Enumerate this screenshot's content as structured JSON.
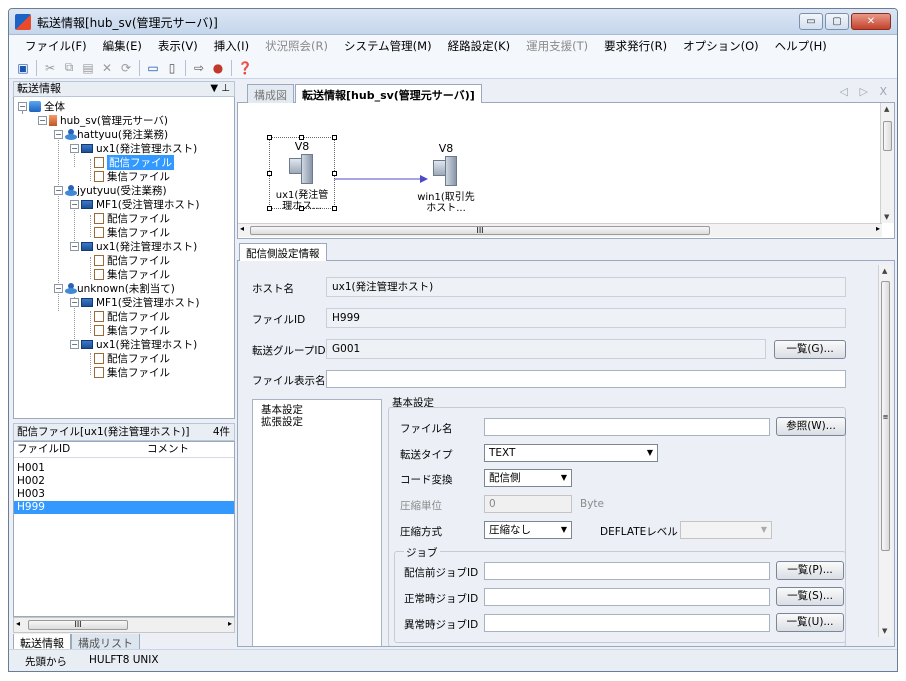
{
  "window": {
    "title": "転送情報[hub_sv(管理元サーバ)]",
    "min_glyph": "▭",
    "max_glyph": "▢",
    "close_glyph": "✕"
  },
  "menu": [
    {
      "label": "ファイル(F)",
      "disabled": false
    },
    {
      "label": "編集(E)",
      "disabled": false
    },
    {
      "label": "表示(V)",
      "disabled": false
    },
    {
      "label": "挿入(I)",
      "disabled": false
    },
    {
      "label": "状況照会(R)",
      "disabled": true
    },
    {
      "label": "システム管理(M)",
      "disabled": false
    },
    {
      "label": "経路設定(K)",
      "disabled": false
    },
    {
      "label": "運用支援(T)",
      "disabled": true
    },
    {
      "label": "要求発行(R)",
      "disabled": false
    },
    {
      "label": "オプション(O)",
      "disabled": false
    },
    {
      "label": "ヘルプ(H)",
      "disabled": false
    }
  ],
  "toolbar": {
    "icons": [
      "save-icon",
      "cut-icon",
      "copy-icon",
      "paste-icon",
      "delete-icon",
      "refresh-icon",
      "new-host-icon",
      "new-file-icon",
      "transfer-icon",
      "stop-icon",
      "help-icon"
    ],
    "glyphs": {
      "save": "▣",
      "cut": "✂",
      "copy": "⧉",
      "paste": "▤",
      "delete": "✕",
      "refresh": "⟳",
      "new_host": "▭",
      "new_file": "▯",
      "transfer": "⇨",
      "stop": "●",
      "help": "❓"
    }
  },
  "left_panel": {
    "header": "転送情報",
    "pin_glyph": "▼ ⊥",
    "tree": {
      "root": "全体",
      "server": "hub_sv(管理元サーバ)",
      "groups": [
        {
          "label": "hattyuu(発注業務)"
        },
        {
          "label": "jyutyuu(受注業務)"
        },
        {
          "label": "unknown(未割当て)"
        }
      ],
      "hosts": {
        "h1": "ux1(発注管理ホスト)",
        "h2": "MF1(受注管理ホスト)",
        "h3": "ux1(発注管理ホスト)",
        "h4": "MF1(受注管理ホスト)",
        "h5": "ux1(発注管理ホスト)"
      },
      "send_file": "配信ファイル",
      "recv_file": "集信ファイル"
    },
    "list_header": "配信ファイル[ux1(発注管理ホスト)]",
    "list_count": "4件",
    "list_columns": [
      "ファイルID",
      "コメント"
    ],
    "list_rows": [
      "H001",
      "H002",
      "H003",
      "H999"
    ],
    "selected_row": "H999",
    "scroll_grip": "III",
    "bottom_tabs": [
      "転送情報",
      "構成リスト"
    ]
  },
  "doc_tabs": {
    "inactive": "構成図",
    "active": "転送情報[hub_sv(管理元サーバ)]",
    "controls": "◁ ▷ X"
  },
  "diagram": {
    "nodes": [
      {
        "version": "V8",
        "label": "ux1(発注管\n理ホス..."
      },
      {
        "version": "V8",
        "label": "win1(取引先\nホスト..."
      }
    ],
    "scroll_grip": "III"
  },
  "detail": {
    "tab": "配信側設定情報",
    "host_label": "ホスト名",
    "host_value": "ux1(発注管理ホスト)",
    "fileid_label": "ファイルID",
    "fileid_value": "H999",
    "group_label": "転送グループID",
    "group_value": "G001",
    "list_button": "一覧(G)...",
    "display_name_label": "ファイル表示名",
    "display_name_value": "",
    "nav": [
      "基本設定",
      "拡張設定"
    ],
    "section_title": "基本設定",
    "filename_label": "ファイル名",
    "filename_value": "",
    "browse_button": "参照(W)...",
    "transfer_type_label": "転送タイプ",
    "transfer_type_value": "TEXT",
    "code_conv_label": "コード変換",
    "code_conv_value": "配信側",
    "comp_unit_label": "圧縮単位",
    "comp_unit_value": "0",
    "comp_unit_suffix": "Byte",
    "comp_method_label": "圧縮方式",
    "comp_method_value": "圧縮なし",
    "deflate_label": "DEFLATEレベル",
    "deflate_value": "",
    "job_group_title": "ジョブ",
    "pre_job_label": "配信前ジョブID",
    "pre_job_value": "",
    "pre_job_button": "一覧(P)...",
    "normal_job_label": "正常時ジョブID",
    "normal_job_value": "",
    "normal_job_button": "一覧(S)...",
    "error_job_label": "異常時ジョブID",
    "error_job_value": "",
    "error_job_button": "一覧(U)...",
    "scroll_grip": "≡"
  },
  "status": {
    "left": "先頭から",
    "center": "HULFT8 UNIX"
  }
}
